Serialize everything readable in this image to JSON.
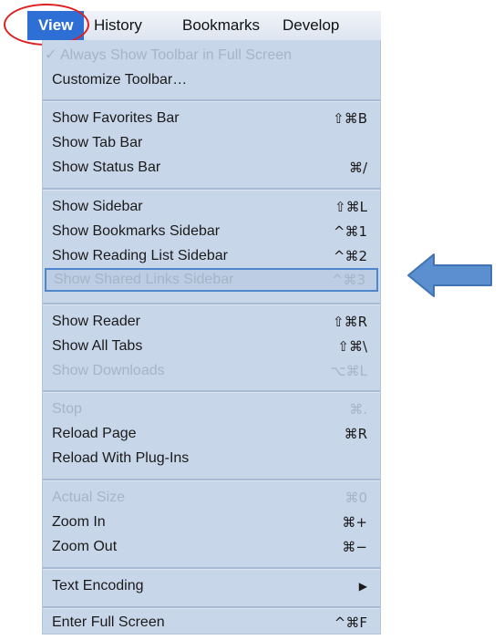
{
  "menubar": {
    "items": [
      {
        "label": "View",
        "active": true
      },
      {
        "label": "History"
      },
      {
        "label": "Bookmarks"
      },
      {
        "label": "Develop"
      }
    ]
  },
  "menu": {
    "items": [
      {
        "label": "Always Show Toolbar in Full Screen",
        "shortcut": "",
        "disabled": true,
        "checked": true
      },
      {
        "label": "Customize Toolbar…",
        "shortcut": ""
      },
      {
        "label": "Show Favorites Bar",
        "shortcut": "⇧⌘B"
      },
      {
        "label": "Show Tab Bar",
        "shortcut": ""
      },
      {
        "label": "Show Status Bar",
        "shortcut": "⌘/"
      },
      {
        "label": "Show Sidebar",
        "shortcut": "⇧⌘L"
      },
      {
        "label": "Show Bookmarks Sidebar",
        "shortcut": "^⌘1"
      },
      {
        "label": "Show Reading List Sidebar",
        "shortcut": "^⌘2"
      },
      {
        "label": "Show Shared Links Sidebar",
        "shortcut": "^⌘3",
        "disabled": true,
        "highlighted": true
      },
      {
        "label": "Show Reader",
        "shortcut": "⇧⌘R"
      },
      {
        "label": "Show All Tabs",
        "shortcut": "⇧⌘\\"
      },
      {
        "label": "Show Downloads",
        "shortcut": "⌥⌘L",
        "disabled": true
      },
      {
        "label": "Stop",
        "shortcut": "⌘.",
        "disabled": true
      },
      {
        "label": "Reload Page",
        "shortcut": "⌘R"
      },
      {
        "label": "Reload With Plug-Ins",
        "shortcut": ""
      },
      {
        "label": "Actual Size",
        "shortcut": "⌘0",
        "disabled": true
      },
      {
        "label": "Zoom In",
        "shortcut": "⌘+"
      },
      {
        "label": "Zoom Out",
        "shortcut": "⌘−"
      },
      {
        "label": "Text Encoding",
        "shortcut": "▶"
      },
      {
        "label": "Enter Full Screen",
        "shortcut": "^⌘F"
      }
    ]
  },
  "colors": {
    "menu_background": "#c8d6ea",
    "active_menubar": "#2e6fd6",
    "annotation_circle": "#e02020",
    "annotation_arrow": "#5b8fcf",
    "disabled_text": "#a6b4c8"
  },
  "annotations": {
    "circle_target": "View",
    "arrow_target": "Show Shared Links Sidebar",
    "arrow_icon": "left-arrow-icon"
  }
}
